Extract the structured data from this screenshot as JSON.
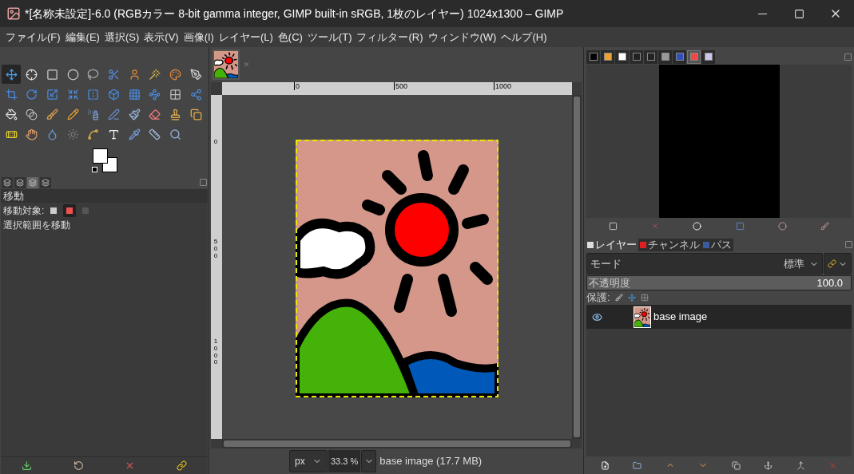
{
  "window": {
    "title": "*[名称未設定]-6.0 (RGBカラー 8-bit gamma integer, GIMP built-in sRGB, 1枚のレイヤー) 1024x1300 – GIMP"
  },
  "menu": [
    "ファイル(F)",
    "編集(E)",
    "選択(S)",
    "表示(V)",
    "画像(I)",
    "レイヤー(L)",
    "色(C)",
    "ツール(T)",
    "フィルター(R)",
    "ウィンドウ(W)",
    "ヘルプ(H)"
  ],
  "toolbox": {
    "tools": [
      {
        "selected": true
      },
      {
        "selected": false
      },
      {
        "selected": false
      },
      {
        "selected": false
      },
      {
        "selected": false
      },
      {
        "selected": false
      },
      {
        "selected": false
      },
      {
        "selected": false
      },
      {
        "selected": false
      },
      {
        "selected": false
      },
      {
        "selected": false
      },
      {
        "selected": false
      },
      {
        "selected": false
      },
      {
        "selected": false
      },
      {
        "selected": false
      },
      {
        "selected": false
      },
      {
        "selected": false
      },
      {
        "selected": false
      },
      {
        "selected": false
      },
      {
        "selected": false
      },
      {
        "selected": false
      },
      {
        "selected": false
      },
      {
        "selected": false
      },
      {
        "selected": false
      },
      {
        "selected": false
      },
      {
        "selected": false
      },
      {
        "selected": false
      },
      {
        "selected": false
      },
      {
        "selected": false
      },
      {
        "selected": false
      },
      {
        "selected": false
      },
      {
        "selected": false
      },
      {
        "selected": false
      },
      {
        "selected": false
      },
      {
        "selected": false
      },
      {
        "selected": false
      },
      {
        "selected": false
      },
      {
        "selected": false
      },
      {
        "selected": false
      }
    ]
  },
  "tool_options": {
    "tabs": [
      {
        "selected": false
      },
      {
        "selected": false
      },
      {
        "selected": true
      },
      {
        "selected": false
      }
    ],
    "title": "移動",
    "target_label": "移動対象:",
    "targets": [
      {
        "selected": false
      },
      {
        "selected": true
      },
      {
        "selected": false
      }
    ],
    "hint": "選択範囲を移動"
  },
  "image_window": {
    "h_ruler": [
      "0",
      "500",
      "1000"
    ],
    "v_ruler": [
      "0",
      "500",
      "1000"
    ],
    "unit": "px",
    "zoom": "33.3 %",
    "status": "base image (17.7 MB)"
  },
  "dock_top": {
    "tabs": [
      {
        "selected": false
      },
      {
        "selected": false
      },
      {
        "selected": false
      },
      {
        "selected": false
      },
      {
        "selected": false
      },
      {
        "selected": false
      },
      {
        "selected": false
      },
      {
        "selected": true
      },
      {
        "selected": false
      }
    ]
  },
  "layers_dock": {
    "tabs": [
      {
        "label": "レイヤー",
        "selected": true
      },
      {
        "label": "チャンネル",
        "selected": false
      },
      {
        "label": "パス",
        "selected": false
      }
    ],
    "mode_label": "モード",
    "mode_value": "標準",
    "opacity_label": "不透明度",
    "opacity_value": "100.0",
    "opacity": {
      "level": 1.0
    },
    "lock_label": "保護:",
    "layers": [
      {
        "name": "base image",
        "visible": true,
        "selected": true
      }
    ]
  }
}
